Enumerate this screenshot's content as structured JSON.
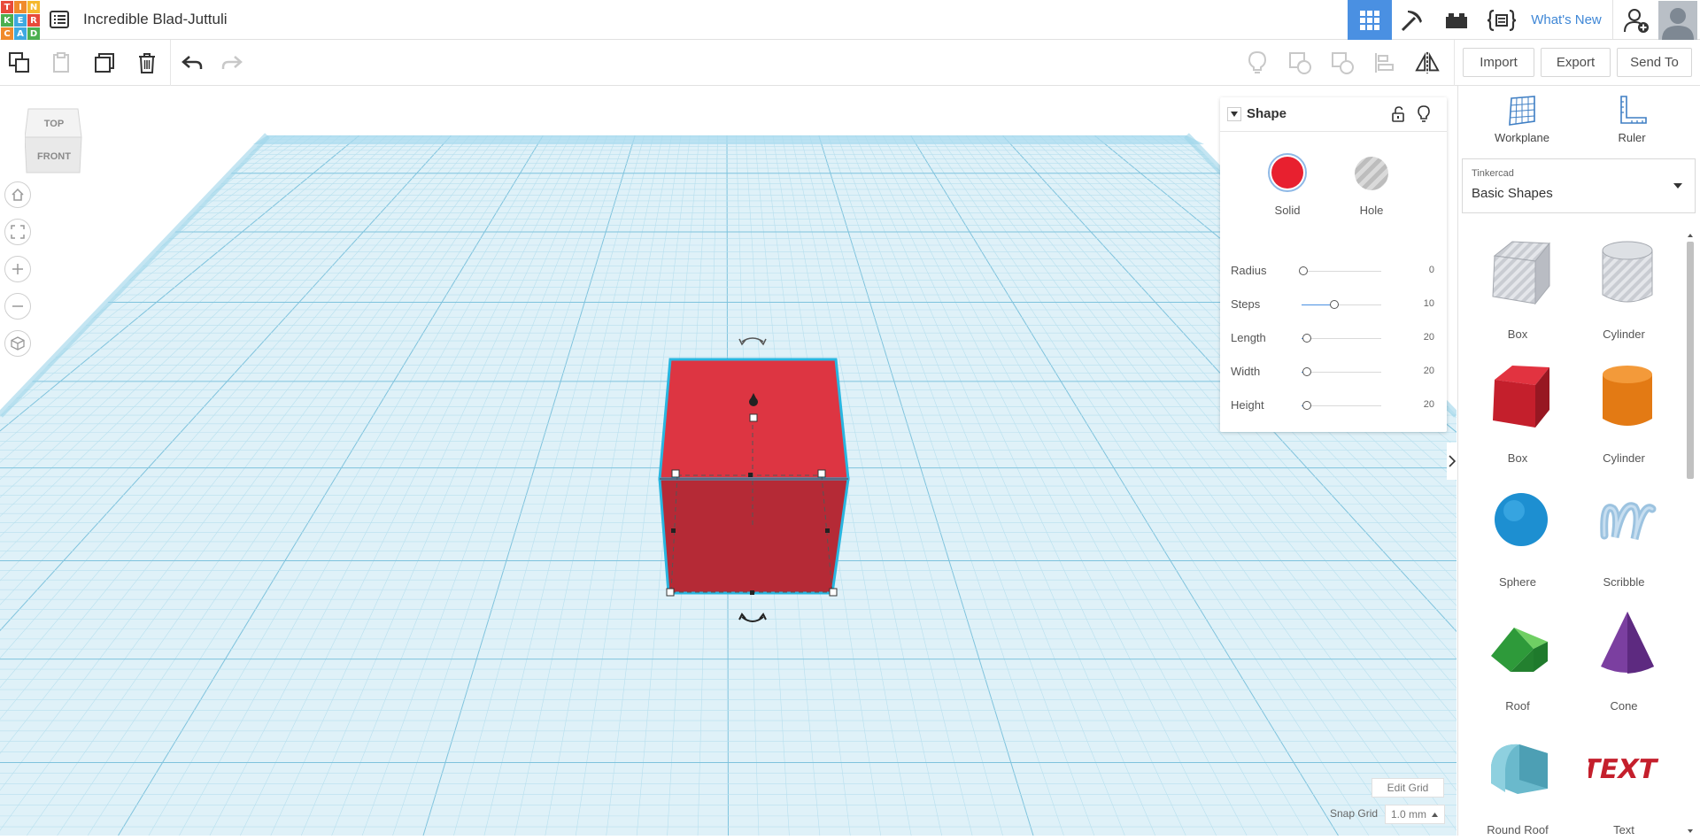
{
  "header": {
    "logo_letters": [
      "T",
      "I",
      "N",
      "K",
      "E",
      "R",
      "C",
      "A",
      "D"
    ],
    "logo_colors": [
      "#e84a3a",
      "#f08a2c",
      "#f5b82e",
      "#4caf50",
      "#3ea9e0",
      "#e84a3a",
      "#f08a2c",
      "#3ea9e0",
      "#4caf50"
    ],
    "title": "Incredible Blad-Juttuli",
    "whats_new": "What's New",
    "accent": "#4a90e2"
  },
  "toolbar": {
    "import_label": "Import",
    "export_label": "Export",
    "send_to_label": "Send To"
  },
  "viewcube": {
    "top": "TOP",
    "front": "FRONT"
  },
  "inspector": {
    "title": "Shape",
    "solid_label": "Solid",
    "hole_label": "Hole",
    "solid_color": "#e8202f",
    "params": [
      {
        "label": "Radius",
        "value": "0",
        "fraction": 0.0
      },
      {
        "label": "Steps",
        "value": "10",
        "fraction": 0.45
      },
      {
        "label": "Length",
        "value": "20",
        "fraction": 0.1
      },
      {
        "label": "Width",
        "value": "20",
        "fraction": 0.1
      },
      {
        "label": "Height",
        "value": "20",
        "fraction": 0.1
      }
    ]
  },
  "grid_controls": {
    "edit_grid": "Edit Grid",
    "snap_grid_label": "Snap Grid",
    "snap_value": "1.0 mm"
  },
  "right_panel": {
    "workplane_label": "Workplane",
    "ruler_label": "Ruler",
    "library_source": "Tinkercad",
    "library_name": "Basic Shapes",
    "shapes": [
      {
        "label": "Box",
        "kind": "box-hole"
      },
      {
        "label": "Cylinder",
        "kind": "cylinder-hole"
      },
      {
        "label": "Box",
        "kind": "box"
      },
      {
        "label": "Cylinder",
        "kind": "cylinder"
      },
      {
        "label": "Sphere",
        "kind": "sphere"
      },
      {
        "label": "Scribble",
        "kind": "scribble"
      },
      {
        "label": "Roof",
        "kind": "roof"
      },
      {
        "label": "Cone",
        "kind": "cone"
      },
      {
        "label": "Round Roof",
        "kind": "round-roof"
      },
      {
        "label": "Text",
        "kind": "text"
      }
    ]
  }
}
